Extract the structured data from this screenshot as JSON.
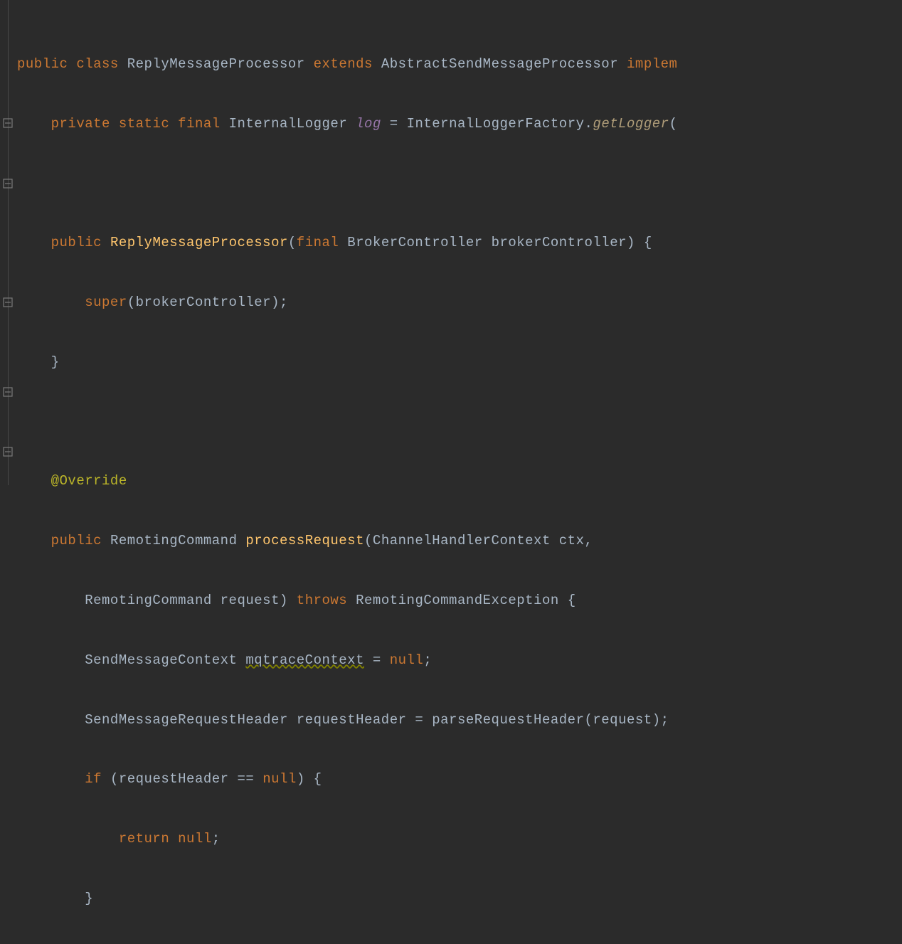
{
  "code": {
    "l1": {
      "kw_public": "public",
      "kw_class": "class",
      "class_name": "ReplyMessageProcessor",
      "kw_extends": "extends",
      "super_class": "AbstractSendMessageProcessor",
      "kw_implem": "implem"
    },
    "l2": {
      "kw_private": "private",
      "kw_static": "static",
      "kw_final": "final",
      "type_logger": "InternalLogger",
      "var_log": "log",
      "eq": "=",
      "factory": "InternalLoggerFactory",
      "dot": ".",
      "method": "getLogger",
      "open": "("
    },
    "l4": {
      "kw_public": "public",
      "ctor": "ReplyMessageProcessor",
      "open": "(",
      "kw_final": "final",
      "type_bc": "BrokerController",
      "param": "brokerController",
      "close": ")",
      "brace": "{"
    },
    "l5": {
      "kw_super": "super",
      "open": "(",
      "arg": "brokerController",
      "close": ")",
      "semi": ";"
    },
    "l6": {
      "brace": "}"
    },
    "l8": {
      "anno": "@Override"
    },
    "l9": {
      "kw_public": "public",
      "ret_type": "RemotingCommand",
      "method": "processRequest",
      "open": "(",
      "p1_type": "ChannelHandlerContext",
      "p1_name": "ctx",
      "comma": ","
    },
    "l10": {
      "p2_type": "RemotingCommand",
      "p2_name": "request",
      "close": ")",
      "kw_throws": "throws",
      "exc": "RemotingCommandException",
      "brace": "{"
    },
    "l11": {
      "type": "SendMessageContext",
      "var": "mqtraceContext",
      "eq": "=",
      "nul": "null",
      "semi": ";"
    },
    "l12": {
      "type": "SendMessageRequestHeader",
      "var": "requestHeader",
      "eq": "=",
      "call": "parseRequestHeader",
      "open": "(",
      "arg": "request",
      "close": ")",
      "semi": ";"
    },
    "l13": {
      "kw_if": "if",
      "open": "(",
      "var": "requestHeader",
      "op": "==",
      "nul": "null",
      "close": ")",
      "brace": "{"
    },
    "l14": {
      "kw_return": "return",
      "nul": "null",
      "semi": ";"
    },
    "l15": {
      "brace": "}"
    }
  },
  "fold_positions": [
    166,
    251,
    418,
    544,
    628
  ]
}
